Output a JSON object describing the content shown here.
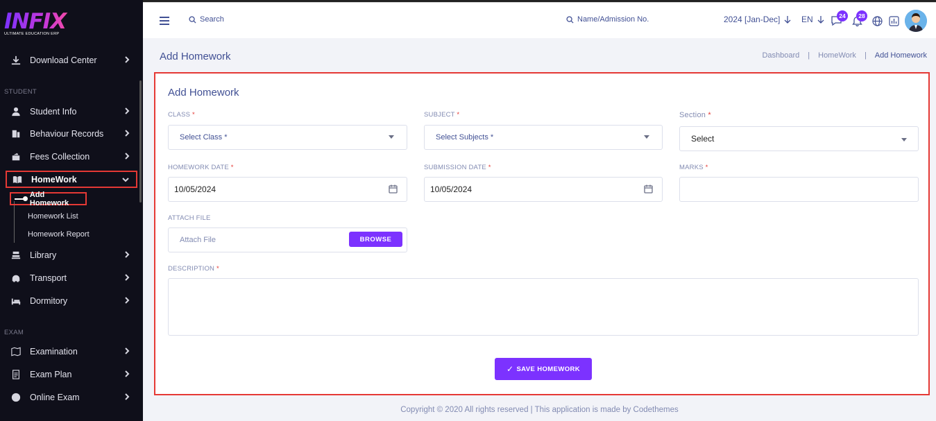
{
  "brand": {
    "name": "INFIX",
    "tagline": "ULTIMATE EDUCATION ERP"
  },
  "sidebar": {
    "items": [
      {
        "label": "Download Center",
        "icon": "download-icon"
      },
      {
        "label": "Student Info",
        "icon": "user-icon"
      },
      {
        "label": "Behaviour Records",
        "icon": "records-icon"
      },
      {
        "label": "Fees Collection",
        "icon": "fees-icon"
      },
      {
        "label": "HomeWork",
        "icon": "book-icon"
      },
      {
        "label": "Library",
        "icon": "library-icon"
      },
      {
        "label": "Transport",
        "icon": "transport-icon"
      },
      {
        "label": "Dormitory",
        "icon": "bed-icon"
      },
      {
        "label": "Examination",
        "icon": "map-icon"
      },
      {
        "label": "Exam Plan",
        "icon": "plan-icon"
      },
      {
        "label": "Online Exam",
        "icon": "globe-icon"
      }
    ],
    "sections": {
      "student": "STUDENT",
      "exam": "EXAM"
    },
    "homework_sub": {
      "add": "Add Homework",
      "list": "Homework List",
      "report": "Homework Report"
    }
  },
  "header": {
    "search_label": "Search",
    "admission_search": "Name/Admission No.",
    "session": "2024 [Jan-Dec]",
    "language": "EN",
    "messages_count": "24",
    "notifications_count": "28"
  },
  "page": {
    "title": "Add Homework",
    "breadcrumb": [
      "Dashboard",
      "HomeWork",
      "Add Homework"
    ]
  },
  "form": {
    "title": "Add Homework",
    "class_label": "CLASS",
    "class_placeholder": "Select Class *",
    "subject_label": "SUBJECT",
    "subject_placeholder": "Select Subjects *",
    "section_label": "Section",
    "section_placeholder": "Select",
    "homework_date_label": "HOMEWORK DATE",
    "homework_date": "10/05/2024",
    "submission_date_label": "SUBMISSION DATE",
    "submission_date": "10/05/2024",
    "marks_label": "MARKS",
    "marks_value": "",
    "attach_label": "ATTACH FILE",
    "attach_placeholder": "Attach File",
    "browse_label": "BROWSE",
    "description_label": "DESCRIPTION",
    "description_value": "",
    "required_mark": "*",
    "save_label": "SAVE HOMEWORK",
    "save_icon": "check-icon"
  },
  "footer": {
    "text": "Copyright © 2020 All rights reserved | This application is made by Codethemes"
  },
  "colors": {
    "accent": "#7c32ff",
    "highlight": "#e53935",
    "text": "#415094",
    "sidebar": "#0f0f1a"
  }
}
